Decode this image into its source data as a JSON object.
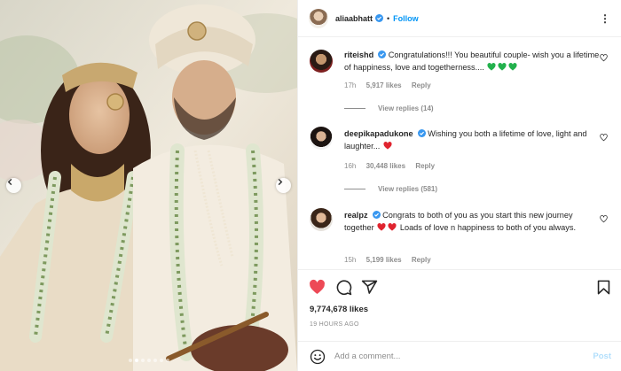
{
  "post": {
    "username": "aliaabhatt",
    "separator": "•",
    "follow_label": "Follow",
    "more_icon": "⋮",
    "carousel": {
      "slide_count": 7,
      "active_slide": 1
    }
  },
  "comments": [
    {
      "username": "riteishd",
      "text": "Congratulations!!! You beautiful couple- wish you a lifetime of happiness, love and togetherness....",
      "emoji": [
        "green-heart",
        "green-heart",
        "green-heart"
      ],
      "emoji_colors": [
        "#22b14c",
        "#22b14c",
        "#22b14c"
      ],
      "time": "17h",
      "likes": "5,917 likes",
      "reply_label": "Reply",
      "view_replies": "View replies (14)"
    },
    {
      "username": "deepikapadukone",
      "text": "Wishing you both a lifetime of love, light and laughter...",
      "emoji": [
        "red-heart"
      ],
      "emoji_colors": [
        "#e0242f"
      ],
      "time": "16h",
      "likes": "30,448 likes",
      "reply_label": "Reply",
      "view_replies": "View replies (581)"
    },
    {
      "username": "realpz",
      "text_before": "Congrats to both of you as you start this new journey together",
      "text_after": "Loads of love n happiness to both of you always.",
      "emoji": [
        "red-heart",
        "red-heart"
      ],
      "emoji_colors": [
        "#e0242f",
        "#e0242f"
      ],
      "time": "15h",
      "likes": "5,199 likes",
      "reply_label": "Reply"
    }
  ],
  "actions": {
    "like_icon": "heart-filled-icon",
    "comment_icon": "comment-icon",
    "share_icon": "paper-plane-icon",
    "save_icon": "bookmark-icon",
    "like_color": "#ed4956"
  },
  "stats": {
    "likes": "9,774,678 likes",
    "timestamp": "19 HOURS AGO"
  },
  "composer": {
    "placeholder": "Add a comment...",
    "post_label": "Post",
    "post_color": "#b2dffc"
  },
  "colors": {
    "link_blue": "#0095f6",
    "verified_blue": "#3897f0",
    "muted_text": "#8e8e8e"
  }
}
